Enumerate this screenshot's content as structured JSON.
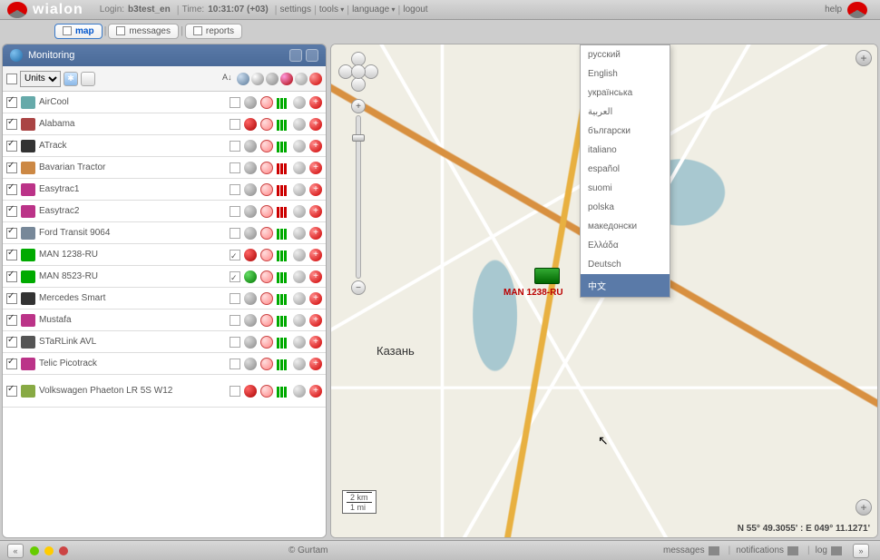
{
  "brand": "wialon",
  "topbar": {
    "login_label": "Login:",
    "login_value": "b3test_en",
    "time_label": "Time:",
    "time_value": "10:31:07 (+03)",
    "settings": "settings",
    "tools": "tools",
    "language": "language",
    "logout": "logout",
    "help": "help"
  },
  "tabs": {
    "map": "map",
    "messages": "messages",
    "reports": "reports"
  },
  "panel": {
    "title": "Monitoring",
    "filter_select": "Units"
  },
  "units": [
    {
      "name": "AirCool",
      "icon": "#6aa",
      "st": "grey",
      "cb2": false,
      "bars": "g"
    },
    {
      "name": "Alabama",
      "icon": "#a44",
      "st": "red",
      "cb2": false,
      "bars": "g"
    },
    {
      "name": "ATrack",
      "icon": "#333",
      "st": "grey",
      "cb2": false,
      "bars": "g"
    },
    {
      "name": "Bavarian Tractor",
      "icon": "#c84",
      "st": "grey",
      "cb2": false,
      "bars": "r"
    },
    {
      "name": "Easytrac1",
      "icon": "#b38",
      "st": "grey",
      "cb2": false,
      "bars": "r"
    },
    {
      "name": "Easytrac2",
      "icon": "#b38",
      "st": "grey",
      "cb2": false,
      "bars": "r"
    },
    {
      "name": "Ford Transit 9064",
      "icon": "#789",
      "st": "grey",
      "cb2": false,
      "bars": "g"
    },
    {
      "name": "MAN 1238-RU",
      "icon": "#0a0",
      "st": "red",
      "cb2": true,
      "bars": "g"
    },
    {
      "name": "MAN 8523-RU",
      "icon": "#0a0",
      "st": "green",
      "cb2": true,
      "bars": "g"
    },
    {
      "name": "Mercedes Smart",
      "icon": "#333",
      "st": "grey",
      "cb2": false,
      "bars": "g"
    },
    {
      "name": "Mustafa",
      "icon": "#b38",
      "st": "grey",
      "cb2": false,
      "bars": "g"
    },
    {
      "name": "STaRLink AVL",
      "icon": "#555",
      "st": "grey",
      "cb2": false,
      "bars": "g"
    },
    {
      "name": "Telic Picotrack",
      "icon": "#b38",
      "st": "grey",
      "cb2": false,
      "bars": "g"
    },
    {
      "name": "Volkswagen Phaeton LR 5S W12",
      "icon": "#8a4",
      "st": "red",
      "cb2": false,
      "bars": "g",
      "tall": true
    }
  ],
  "map": {
    "city": "Казань",
    "unit_label": "MAN 1238-RU",
    "scale_km": "2 km",
    "scale_mi": "1 mi",
    "coords": "N 55° 49.3055' : E 049° 11.1271'"
  },
  "languages": [
    "русский",
    "English",
    "українська",
    "العربية",
    "български",
    "italiano",
    "español",
    "suomi",
    "polska",
    "македонски",
    "Ελλάδα",
    "Deutsch",
    "中文"
  ],
  "lang_selected_index": 12,
  "bottom": {
    "copyright": "© Gurtam",
    "messages": "messages",
    "notifications": "notifications",
    "log": "log"
  }
}
